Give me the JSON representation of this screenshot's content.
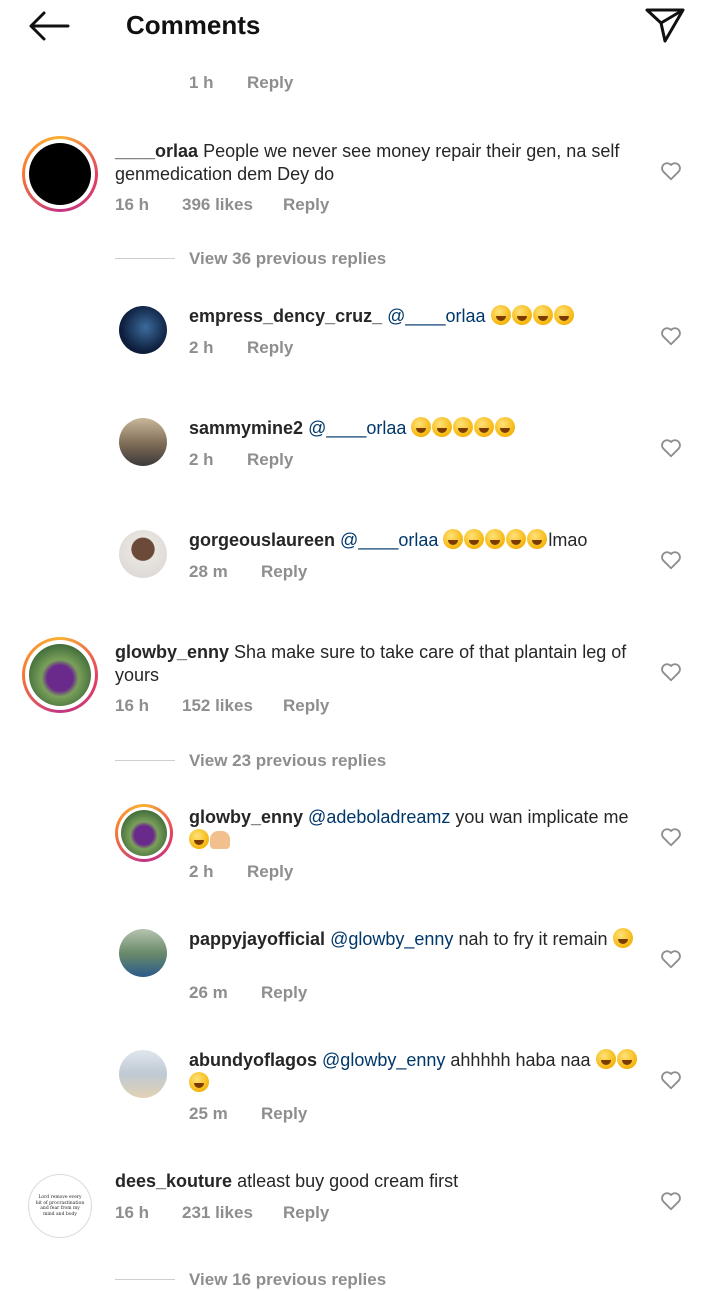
{
  "header": {
    "title": "Comments"
  },
  "reply_label": "Reply",
  "top_reply": {
    "time": "1 h"
  },
  "threads": [
    {
      "comment": {
        "user": "____orlaa",
        "text": "People we never see money repair their gen, na self genmedication dem Dey do",
        "time": "16 h",
        "likes": "396 likes"
      },
      "view_replies": "View 36 previous replies",
      "replies": [
        {
          "user": "empress_dency_cruz_",
          "mention": "@____orlaa",
          "text": "",
          "time": "2 h"
        },
        {
          "user": "sammymine2",
          "mention": "@____orlaa",
          "text": "",
          "time": "2 h"
        },
        {
          "user": "gorgeouslaureen",
          "mention": "@____orlaa",
          "text": "lmao",
          "time": "28 m"
        }
      ]
    },
    {
      "comment": {
        "user": "glowby_enny",
        "text": "Sha make sure to take care of that plantain leg of yours",
        "time": "16 h",
        "likes": "152 likes"
      },
      "view_replies": "View 23 previous replies",
      "replies": [
        {
          "user": "glowby_enny",
          "mention": "@adeboladreamz",
          "text": "you wan implicate me",
          "time": "2 h"
        },
        {
          "user": "pappyjayofficial",
          "mention": "@glowby_enny",
          "text": "nah to fry it remain",
          "time": "26 m"
        },
        {
          "user": "abundyoflagos",
          "mention": "@glowby_enny",
          "text": "ahhhhh haba naa",
          "time": "25 m"
        }
      ]
    },
    {
      "comment": {
        "user": "dees_kouture",
        "text": "atleast buy good cream first",
        "time": "16 h",
        "likes": "231 likes"
      },
      "view_replies": "View 16 previous replies",
      "avatar_text": "Lord remove every bit of procrastination and fear from my mind and body"
    }
  ],
  "icons": {
    "back": "arrow-left-icon",
    "send": "paper-plane-icon",
    "like": "heart-outline-icon"
  },
  "colors": {
    "mention": "#00376b",
    "meta": "#8e8e8e",
    "ring": "#e4405f"
  }
}
